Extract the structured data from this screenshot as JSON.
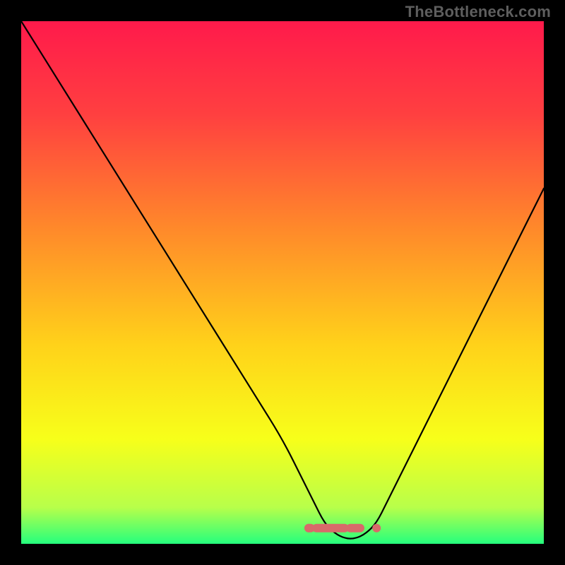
{
  "watermark": "TheBottleneck.com",
  "chart_data": {
    "type": "line",
    "title": "",
    "xlabel": "",
    "ylabel": "",
    "xlim": [
      0,
      100
    ],
    "ylim": [
      0,
      100
    ],
    "x": [
      0,
      5,
      10,
      15,
      20,
      25,
      30,
      35,
      40,
      45,
      50,
      54,
      56,
      58,
      60,
      62,
      64,
      66,
      68,
      70,
      75,
      80,
      85,
      90,
      95,
      100
    ],
    "values": [
      100,
      92,
      84,
      76,
      68,
      60,
      52,
      44,
      36,
      28,
      20,
      12,
      8,
      4,
      2,
      1,
      1,
      2,
      4,
      8,
      18,
      28,
      38,
      48,
      58,
      68
    ],
    "highlight_band": {
      "y_from": 0,
      "y_to": 6
    },
    "flat_marker": {
      "x_from": 55,
      "x_to": 68,
      "y": 3
    },
    "gradient_stops": [
      {
        "offset": 0.0,
        "color": "#ff1a4b"
      },
      {
        "offset": 0.18,
        "color": "#ff4040"
      },
      {
        "offset": 0.4,
        "color": "#ff8a2a"
      },
      {
        "offset": 0.62,
        "color": "#ffd21a"
      },
      {
        "offset": 0.8,
        "color": "#f7ff1a"
      },
      {
        "offset": 0.93,
        "color": "#b8ff4a"
      },
      {
        "offset": 1.0,
        "color": "#25ff7d"
      }
    ],
    "curve_color": "#000000",
    "marker_color": "#d86a6a"
  }
}
